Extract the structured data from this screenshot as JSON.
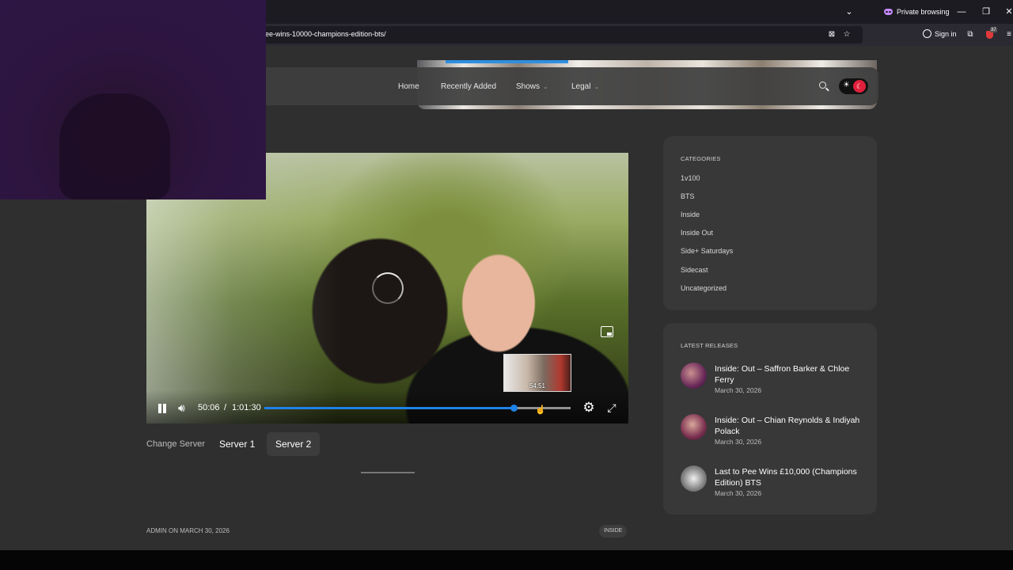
{
  "browser": {
    "private_label": "Private browsing",
    "url": "ee-wins-10000-champions-edition-bts/",
    "signin_label": "Sign in",
    "extension_count": "37"
  },
  "site_nav": {
    "items": [
      {
        "label": "Home",
        "has_dropdown": false
      },
      {
        "label": "Recently Added",
        "has_dropdown": false
      },
      {
        "label": "Shows",
        "has_dropdown": true
      },
      {
        "label": "Legal",
        "has_dropdown": true
      }
    ]
  },
  "player": {
    "current_time": "50:06",
    "separator": "/",
    "duration": "1:01:30",
    "progress_fraction": 0.814,
    "hover_preview_time": "54:51",
    "state": "playing",
    "loading": true
  },
  "servers": {
    "label": "Change Server",
    "options": [
      "Server 1",
      "Server 2"
    ],
    "active": "Server 2"
  },
  "post": {
    "meta": "ADMIN ON MARCH 30, 2026",
    "tag": "INSIDE"
  },
  "categories": {
    "title": "CATEGORIES",
    "items": [
      "1v100",
      "BTS",
      "Inside",
      "Inside Out",
      "Side+ Saturdays",
      "Sidecast",
      "Uncategorized"
    ]
  },
  "latest_releases": {
    "title": "LATEST RELEASES",
    "items": [
      {
        "title": "Inside: Out – Saffron Barker & Chloe Ferry",
        "date": "March 30, 2026"
      },
      {
        "title": "Inside: Out – Chian Reynolds & Indiyah Polack",
        "date": "March 30, 2026"
      },
      {
        "title": "Last to Pee Wins £10,000 (Champions Edition) BTS",
        "date": "March 30, 2026"
      }
    ]
  },
  "colors": {
    "accent": "#1e82e6",
    "toggle": "#e0203c",
    "private": "#c689ff"
  }
}
